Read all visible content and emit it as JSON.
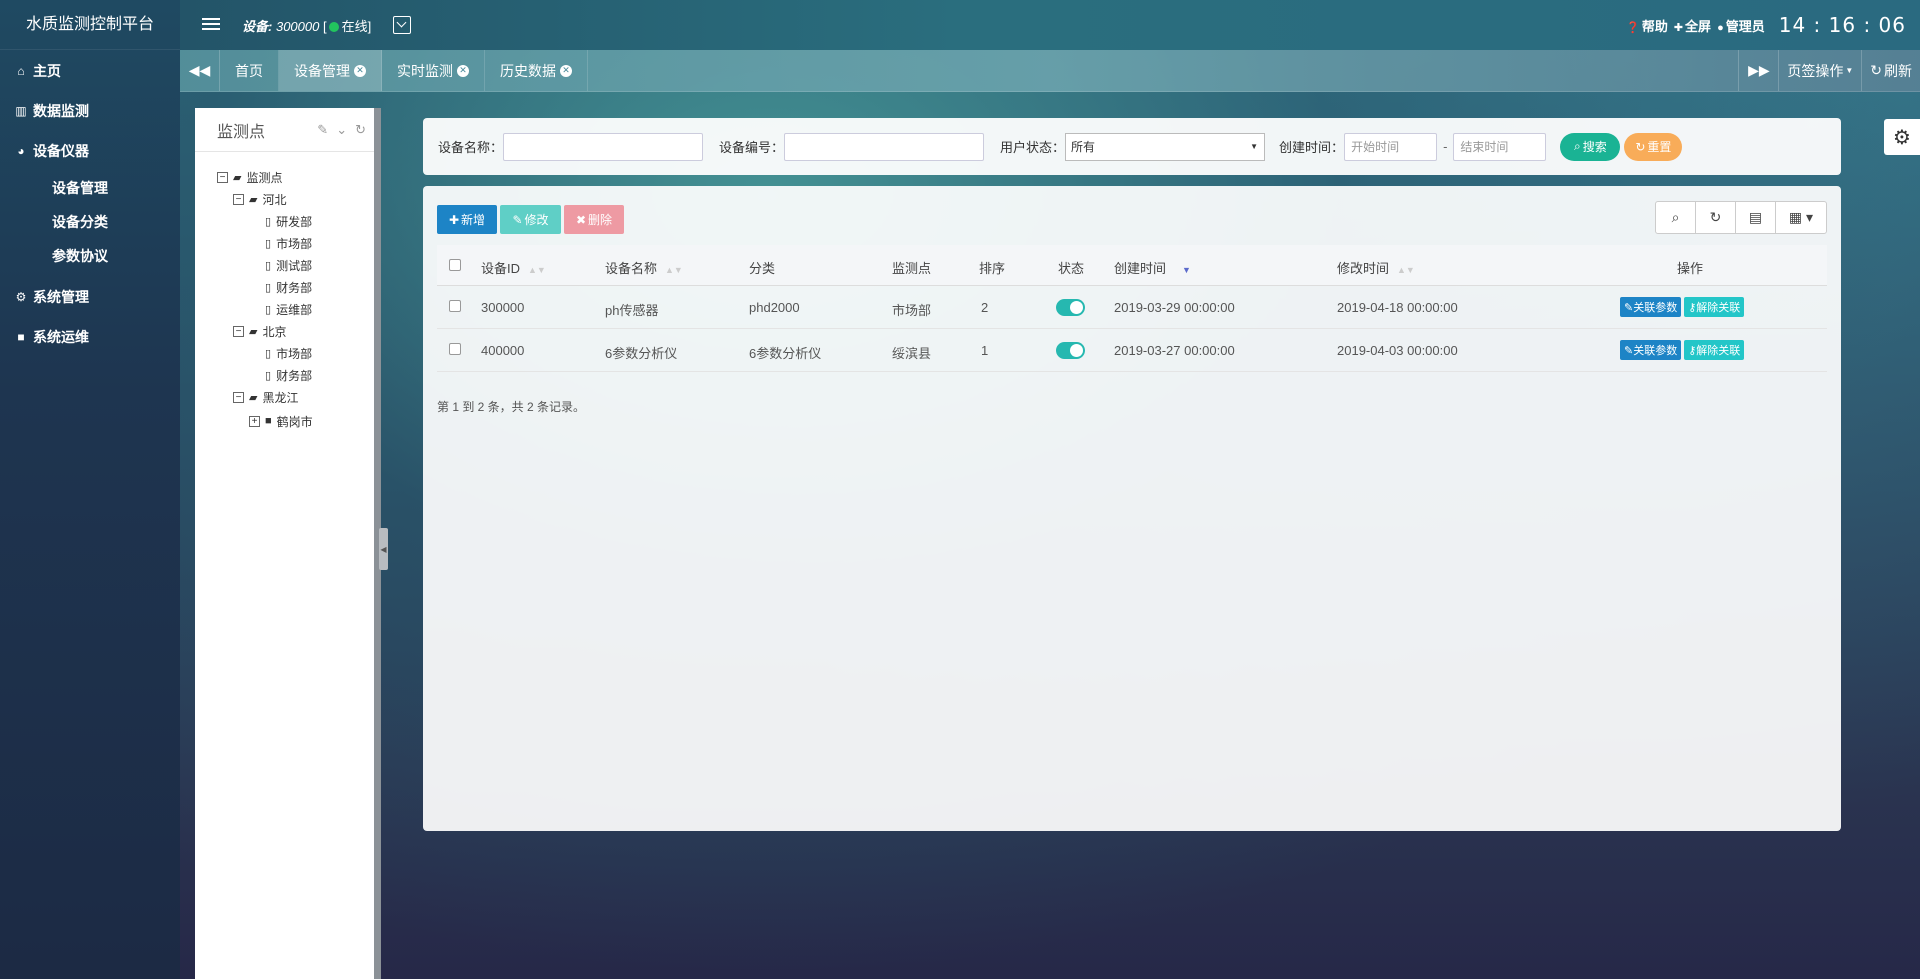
{
  "app": {
    "title": "水质监测控制平台"
  },
  "sidebar": {
    "items": [
      {
        "label": "主页",
        "icon": "home-icon"
      },
      {
        "label": "数据监测",
        "icon": "bar-chart-icon"
      },
      {
        "label": "设备仪器",
        "icon": "dashboard-icon"
      },
      {
        "label": "系统管理",
        "icon": "gear-icon"
      },
      {
        "label": "系统运维",
        "icon": "video-camera-icon"
      }
    ],
    "subitems": [
      "设备管理",
      "设备分类",
      "参数协议"
    ]
  },
  "header": {
    "device_prefix": "设备:",
    "device_id": "300000",
    "bracket": "[",
    "status": "在线",
    "status_color": "#22c55e",
    "help": "帮助",
    "fullscreen": "全屏",
    "user": "管理员",
    "clock": "14 : 16 : 06"
  },
  "tabs": {
    "items": [
      {
        "label": "首页"
      },
      {
        "label": "设备管理"
      },
      {
        "label": "实时监测"
      },
      {
        "label": "历史数据"
      }
    ],
    "page_ops": "页签操作",
    "refresh": "刷新"
  },
  "tree": {
    "title": "监测点",
    "nodes": [
      {
        "label": "监测点"
      },
      {
        "label": "河北"
      },
      {
        "label": "研发部"
      },
      {
        "label": "市场部"
      },
      {
        "label": "测试部"
      },
      {
        "label": "财务部"
      },
      {
        "label": "运维部"
      },
      {
        "label": "北京"
      },
      {
        "label": "市场部"
      },
      {
        "label": "财务部"
      },
      {
        "label": "黑龙江"
      },
      {
        "label": "鹤岗市"
      }
    ]
  },
  "search": {
    "device_name_label": "设备名称：",
    "device_no_label": "设备编号：",
    "user_status_label": "用户状态：",
    "user_status_value": "所有",
    "create_time_label": "创建时间：",
    "start_placeholder": "开始时间",
    "dash": "-",
    "end_placeholder": "结束时间",
    "search_btn": "搜索",
    "reset_btn": "重置"
  },
  "toolbar": {
    "add": "新增",
    "edit": "修改",
    "delete": "删除"
  },
  "table": {
    "headers": [
      "设备ID",
      "设备名称",
      "分类",
      "监测点",
      "排序",
      "状态",
      "创建时间",
      "修改时间",
      "操作"
    ],
    "rows": [
      {
        "id": "300000",
        "name": "ph传感器",
        "category": "phd2000",
        "point": "市场部",
        "order": "2",
        "created": "2019-03-29 00:00:00",
        "modified": "2019-04-18 00:00:00"
      },
      {
        "id": "400000",
        "name": "6参数分析仪",
        "category": "6参数分析仪",
        "point": "绥滨县",
        "order": "1",
        "created": "2019-03-27 00:00:00",
        "modified": "2019-04-03 00:00:00"
      }
    ],
    "link_btn": "关联参数",
    "unlink_btn": "解除关联",
    "summary": "第 1 到 2 条，共 2 条记录。"
  },
  "colors": {
    "primary_btn": "#1d84c6",
    "edit_btn": "#5fcfc6",
    "delete_btn": "#ee9aa3",
    "search_btn": "#1ab394",
    "reset_btn": "#f8ac59",
    "unlink_btn": "#23c6c8"
  }
}
